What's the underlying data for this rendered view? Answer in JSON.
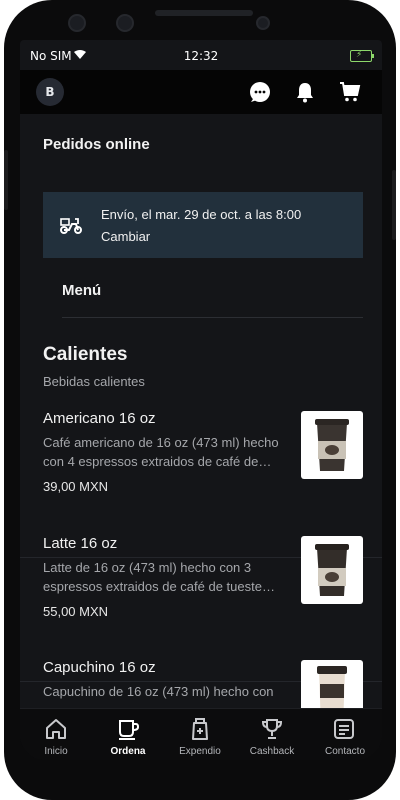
{
  "status_bar": {
    "carrier": "No SIM",
    "time": "12:32"
  },
  "header": {
    "avatar_initial": "B",
    "icons": [
      "chat-bubble-icon",
      "bell-icon",
      "cart-icon"
    ]
  },
  "page": {
    "title": "Pedidos online"
  },
  "delivery": {
    "icon": "scooter-icon",
    "text": "Envío, el mar. 29 de oct. a las 8:00",
    "change_label": "Cambiar"
  },
  "menu": {
    "label": "Menú"
  },
  "category": {
    "title": "Calientes",
    "subtitle": "Bebidas calientes",
    "products": [
      {
        "name": "Americano 16 oz",
        "description": "Café americano de 16 oz (473 ml) hecho con 4  espressos extraidos de café de…",
        "price": "39,00 MXN"
      },
      {
        "name": "Latte 16 oz",
        "description": "Latte de 16 oz (473 ml) hecho con 3 espressos extraidos de café de tueste…",
        "price": "55,00 MXN"
      },
      {
        "name": "Capuchino 16 oz",
        "description": "Capuchino de 16 oz (473 ml) hecho con",
        "price": ""
      }
    ]
  },
  "bottom_nav": {
    "items": [
      {
        "label": "Inicio",
        "icon": "home-icon",
        "active": false
      },
      {
        "label": "Ordena",
        "icon": "cup-icon",
        "active": true
      },
      {
        "label": "Expendio",
        "icon": "coffee-bag-icon",
        "active": false
      },
      {
        "label": "Cashback",
        "icon": "trophy-icon",
        "active": false
      },
      {
        "label": "Contacto",
        "icon": "contact-icon",
        "active": false
      }
    ]
  },
  "colors": {
    "screen_bg": "#141518",
    "delivery_bg": "#22303c",
    "nav_bg": "#0c0c0d",
    "battery": "#8dd86b"
  }
}
